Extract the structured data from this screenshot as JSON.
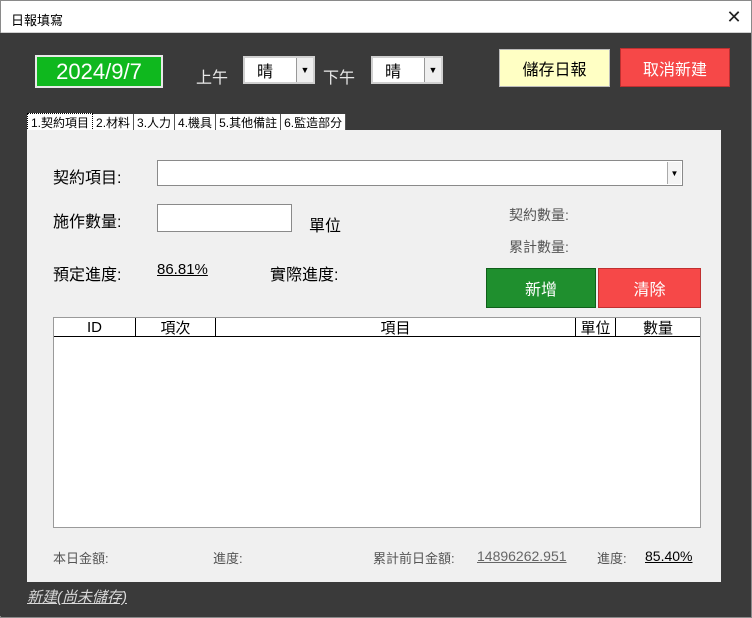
{
  "window": {
    "title": "日報填寫",
    "close": "✕"
  },
  "header": {
    "date": "2024/9/7",
    "am_label": "上午",
    "am_weather": "晴",
    "pm_label": "下午",
    "pm_weather": "晴",
    "save_label": "儲存日報",
    "cancel_label": "取消新建"
  },
  "tabs": [
    {
      "label": "1.契約項目"
    },
    {
      "label": "2.材料"
    },
    {
      "label": "3.人力"
    },
    {
      "label": "4.機具"
    },
    {
      "label": "5.其他備註"
    },
    {
      "label": "6.監造部分"
    }
  ],
  "form": {
    "contract_item_label": "契約項目:",
    "contract_item_value": "",
    "quantity_label": "施作數量:",
    "quantity_value": "",
    "unit_label": "單位",
    "contract_qty_label": "契約數量:",
    "cumulative_qty_label": "累計數量:",
    "planned_progress_label": "預定進度:",
    "planned_progress_value": "86.81%",
    "actual_progress_label": "實際進度:",
    "add_label": "新增",
    "clear_label": "清除"
  },
  "table": {
    "columns": [
      "ID",
      "項次",
      "項目",
      "單位",
      "數量"
    ],
    "rows": []
  },
  "summary": {
    "today_amount_label": "本日金額:",
    "progress_label": "進度:",
    "prev_amount_label": "累計前日金額:",
    "prev_amount_value": "14896262.951",
    "progress2_label": "進度:",
    "progress2_value": "85.40%"
  },
  "status": {
    "text": "新建(尚未儲存)"
  },
  "icons": {
    "close": "close-icon",
    "dropdown": "chevron-down-icon"
  }
}
